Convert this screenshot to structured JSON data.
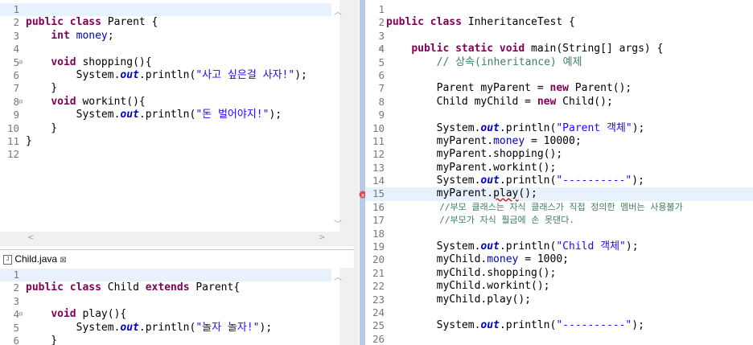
{
  "parent_editor": {
    "lines": [
      {
        "n": "1",
        "code": ""
      },
      {
        "n": "2",
        "code": "public class Parent {"
      },
      {
        "n": "3",
        "code": "    int money;"
      },
      {
        "n": "4",
        "code": ""
      },
      {
        "n": "5",
        "code": "    void shopping(){"
      },
      {
        "n": "6",
        "code": "        System.out.println(\"사고 싶은걸 사자!\");"
      },
      {
        "n": "7",
        "code": "    }"
      },
      {
        "n": "8",
        "code": "    void workint(){"
      },
      {
        "n": "9",
        "code": "        System.out.println(\"돈 벌어야지!\");"
      },
      {
        "n": "10",
        "code": "    }"
      },
      {
        "n": "11",
        "code": "}"
      },
      {
        "n": "12",
        "code": ""
      }
    ]
  },
  "child_tab": {
    "label": "Child.java",
    "close": "⊠"
  },
  "child_editor": {
    "lines": [
      {
        "n": "1",
        "code": ""
      },
      {
        "n": "2",
        "code": "public class Child extends Parent{"
      },
      {
        "n": "3",
        "code": ""
      },
      {
        "n": "4",
        "code": "    void play(){"
      },
      {
        "n": "5",
        "code": "        System.out.println(\"놀자 놀자!\");"
      },
      {
        "n": "6",
        "code": "    }"
      }
    ]
  },
  "main_editor": {
    "lines": [
      {
        "n": "1",
        "code": ""
      },
      {
        "n": "2",
        "code": "public class InheritanceTest {"
      },
      {
        "n": "3",
        "code": ""
      },
      {
        "n": "4",
        "code": "    public static void main(String[] args) {"
      },
      {
        "n": "5",
        "code": "        // 상속(inheritance) 예제"
      },
      {
        "n": "6",
        "code": ""
      },
      {
        "n": "7",
        "code": "        Parent myParent = new Parent();"
      },
      {
        "n": "8",
        "code": "        Child myChild = new Child();"
      },
      {
        "n": "9",
        "code": ""
      },
      {
        "n": "10",
        "code": "        System.out.println(\"Parent 객체\");"
      },
      {
        "n": "11",
        "code": "        myParent.money = 10000;"
      },
      {
        "n": "12",
        "code": "        myParent.shopping();"
      },
      {
        "n": "13",
        "code": "        myParent.workint();"
      },
      {
        "n": "14",
        "code": "        System.out.println(\"----------\");"
      },
      {
        "n": "15",
        "code": "        myParent.play();"
      },
      {
        "n": "16",
        "code": "        //부모 클래스는 자식 클래스가 직접 정의한 멤버는 사용불가"
      },
      {
        "n": "17",
        "code": "        //부모가 자식 훨금에 손 못댄다."
      },
      {
        "n": "18",
        "code": ""
      },
      {
        "n": "19",
        "code": "        System.out.println(\"Child 객체\");"
      },
      {
        "n": "20",
        "code": "        myChild.money = 1000;"
      },
      {
        "n": "21",
        "code": "        myChild.shopping();"
      },
      {
        "n": "22",
        "code": "        myChild.workint();"
      },
      {
        "n": "23",
        "code": "        myChild.play();"
      },
      {
        "n": "24",
        "code": ""
      },
      {
        "n": "25",
        "code": "        System.out.println(\"----------\");"
      },
      {
        "n": "26",
        "code": ""
      }
    ]
  }
}
